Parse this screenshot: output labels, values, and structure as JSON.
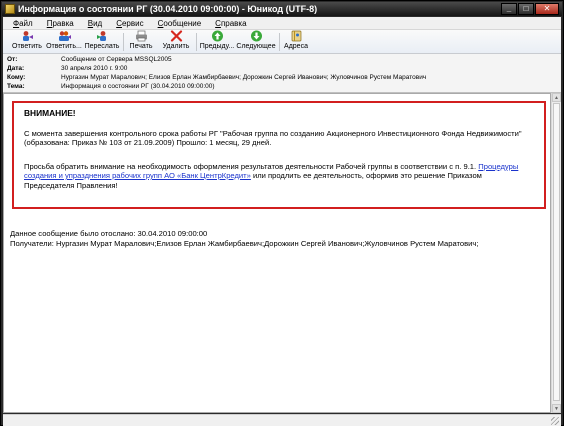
{
  "window": {
    "title": "Информация о состоянии РГ (30.04.2010 09:00:00) - Юникод (UTF-8)",
    "controls": [
      "_",
      "□",
      "✕"
    ]
  },
  "menu": [
    {
      "underline": "Ф",
      "rest": "айл"
    },
    {
      "underline": "П",
      "rest": "равка"
    },
    {
      "underline": "В",
      "rest": "ид"
    },
    {
      "underline": "С",
      "rest": "ервис"
    },
    {
      "underline": "С",
      "rest": "ообщение"
    },
    {
      "underline": "С",
      "rest": "правка"
    }
  ],
  "toolbar": {
    "reply": "Ответить",
    "reply_all": "Ответить...",
    "forward": "Переслать",
    "print": "Печать",
    "delete": "Удалить",
    "previous": "Предыду...",
    "next": "Следующее",
    "addresses": "Адреса"
  },
  "colors": {
    "alert_border": "#d21f1f",
    "link": "#1a33cc",
    "delete_icon": "#d6271e",
    "nav_icon": "#3aa93a"
  },
  "header": {
    "from_label": "От:",
    "from_value": "Сообщение от Сервера MSSQL2005",
    "date_label": "Дата:",
    "date_value": "30 апреля 2010 г. 9:00",
    "to_label": "Кому:",
    "to_value": "Нургазин Мурат Маралович; Елизов Ерлан Жамбирбаевич; Дорожкин Сергей Иванович; Жуловчинов Рустем Маратович",
    "subject_label": "Тема:",
    "subject_value": "Информация о состоянии РГ (30.04.2010 09:00:00)"
  },
  "message": {
    "alert_heading": "ВНИМАНИЕ!",
    "para1": "С момента завершения контрольного срока работы РГ \"Рабочая группа по созданию Акционерного Инвестиционного Фонда Недвижимости\" (образована: Приказ № 103 от 21.09.2009) Прошло: 1 месяц, 29 дней.",
    "para2_start": "Просьба обратить внимание на необходимость оформления результатов деятельности Рабочей группы в соответствии с п. 9.1.",
    "para2_link": "Процедуры создания и упразднения рабочих групп АО «Банк ЦентрКредит»",
    "para2_end": "или продлить ее деятельность, оформив это решение Приказом Председателя Правления!",
    "sent_line": "Данное сообщение было отослано: 30.04.2010 09:00:00",
    "recipients_line": "Получатели: Нургазин Мурат Маралович;Елизов Ерлан Жамбирбаевич;Дорожкин Сергей Иванович;Жуловчинов Рустем Маратович;"
  }
}
